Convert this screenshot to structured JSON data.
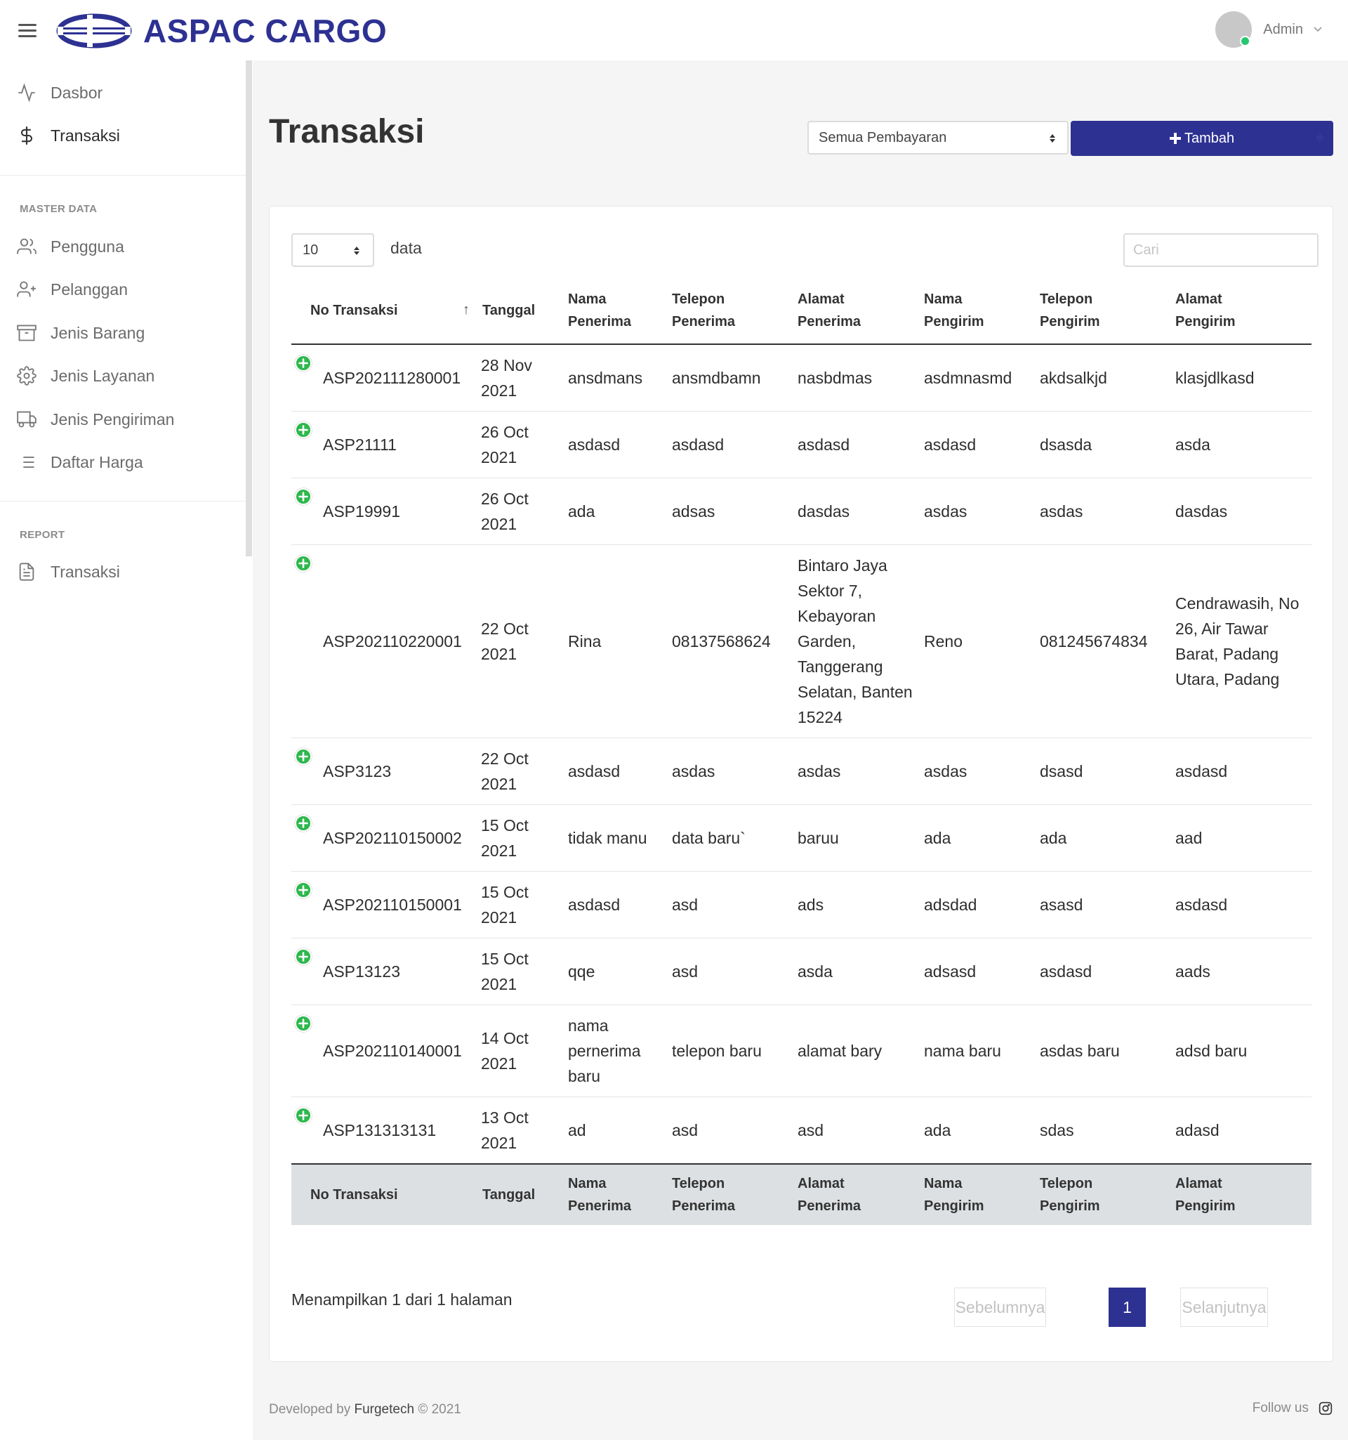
{
  "app": {
    "brand": "ASPAC CARGO",
    "user_name": "Admin"
  },
  "colors": {
    "brand": "#2d3192",
    "status_online": "#28c76f",
    "expand_icon": "#2db84d"
  },
  "sidebar": {
    "items": [
      {
        "label": "Dasbor",
        "icon": "activity-icon"
      },
      {
        "label": "Transaksi",
        "icon": "dollar-icon"
      }
    ],
    "master_title": "MASTER DATA",
    "master_items": [
      {
        "label": "Pengguna",
        "icon": "users-icon"
      },
      {
        "label": "Pelanggan",
        "icon": "user-plus-icon"
      },
      {
        "label": "Jenis Barang",
        "icon": "archive-icon"
      },
      {
        "label": "Jenis Layanan",
        "icon": "settings-icon"
      },
      {
        "label": "Jenis Pengiriman",
        "icon": "truck-icon"
      },
      {
        "label": "Daftar Harga",
        "icon": "list-icon"
      }
    ],
    "report_title": "REPORT",
    "report_items": [
      {
        "label": "Transaksi",
        "icon": "file-text-icon"
      }
    ]
  },
  "page": {
    "title": "Transaksi",
    "payment_filter": "Semua Pembayaran",
    "add_button": "Tambah"
  },
  "table": {
    "page_length": "10",
    "length_label": "data",
    "search_placeholder": "Cari",
    "headers": [
      [
        "No Transaksi"
      ],
      [
        "Tanggal"
      ],
      [
        "Nama",
        "Penerima"
      ],
      [
        "Telepon",
        "Penerima"
      ],
      [
        "Alamat",
        "Penerima"
      ],
      [
        "Nama",
        "Pengirim"
      ],
      [
        "Telepon",
        "Pengirim"
      ],
      [
        "Alamat",
        "Pengirim"
      ]
    ],
    "rows": [
      [
        "ASP202111280001",
        "28 Nov 2021",
        "ansdmans",
        "ansmdbamn",
        "nasbdmas",
        "asdmnasmd",
        "akdsalkjd",
        "klasjdlkasd"
      ],
      [
        "ASP21111",
        "26 Oct 2021",
        "asdasd",
        "asdasd",
        "asdasd",
        "asdasd",
        "dsasda",
        "asda"
      ],
      [
        "ASP19991",
        "26 Oct 2021",
        "ada",
        "adsas",
        "dasdas",
        "asdas",
        "asdas",
        "dasdas"
      ],
      [
        "ASP202110220001",
        "22 Oct 2021",
        "Rina",
        "08137568624",
        "Bintaro Jaya Sektor 7, Kebayoran Garden, Tanggerang Selatan, Banten 15224",
        "Reno",
        "081245674834",
        "Cendrawasih, No 26, Air Tawar Barat, Padang Utara, Padang"
      ],
      [
        "ASP3123",
        "22 Oct 2021",
        "asdasd",
        "asdas",
        "asdas",
        "asdas",
        "dsasd",
        "asdasd"
      ],
      [
        "ASP202110150002",
        "15 Oct 2021",
        "tidak manu",
        "data baru`",
        "baruu",
        "ada",
        "ada",
        "aad"
      ],
      [
        "ASP202110150001",
        "15 Oct 2021",
        "asdasd",
        "asd",
        "ads",
        "adsdad",
        "asasd",
        "asdasd"
      ],
      [
        "ASP13123",
        "15 Oct 2021",
        "qqe",
        "asd",
        "asda",
        "adsasd",
        "asdasd",
        "aads"
      ],
      [
        "ASP202110140001",
        "14 Oct 2021",
        "nama pernerima baru",
        "telepon baru",
        "alamat bary",
        "nama baru",
        "asdas baru",
        "adsd baru"
      ],
      [
        "ASP131313131",
        "13 Oct 2021",
        "ad",
        "asd",
        "asd",
        "ada",
        "sdas",
        "adasd"
      ]
    ]
  },
  "pagination": {
    "info": "Menampilkan 1 dari 1 halaman",
    "prev": "Sebelumnya",
    "current": "1",
    "next": "Selanjutnya"
  },
  "footer": {
    "developed_by": "Developed by",
    "company": "Furgetech",
    "copyright": "© 2021",
    "follow": "Follow us"
  }
}
